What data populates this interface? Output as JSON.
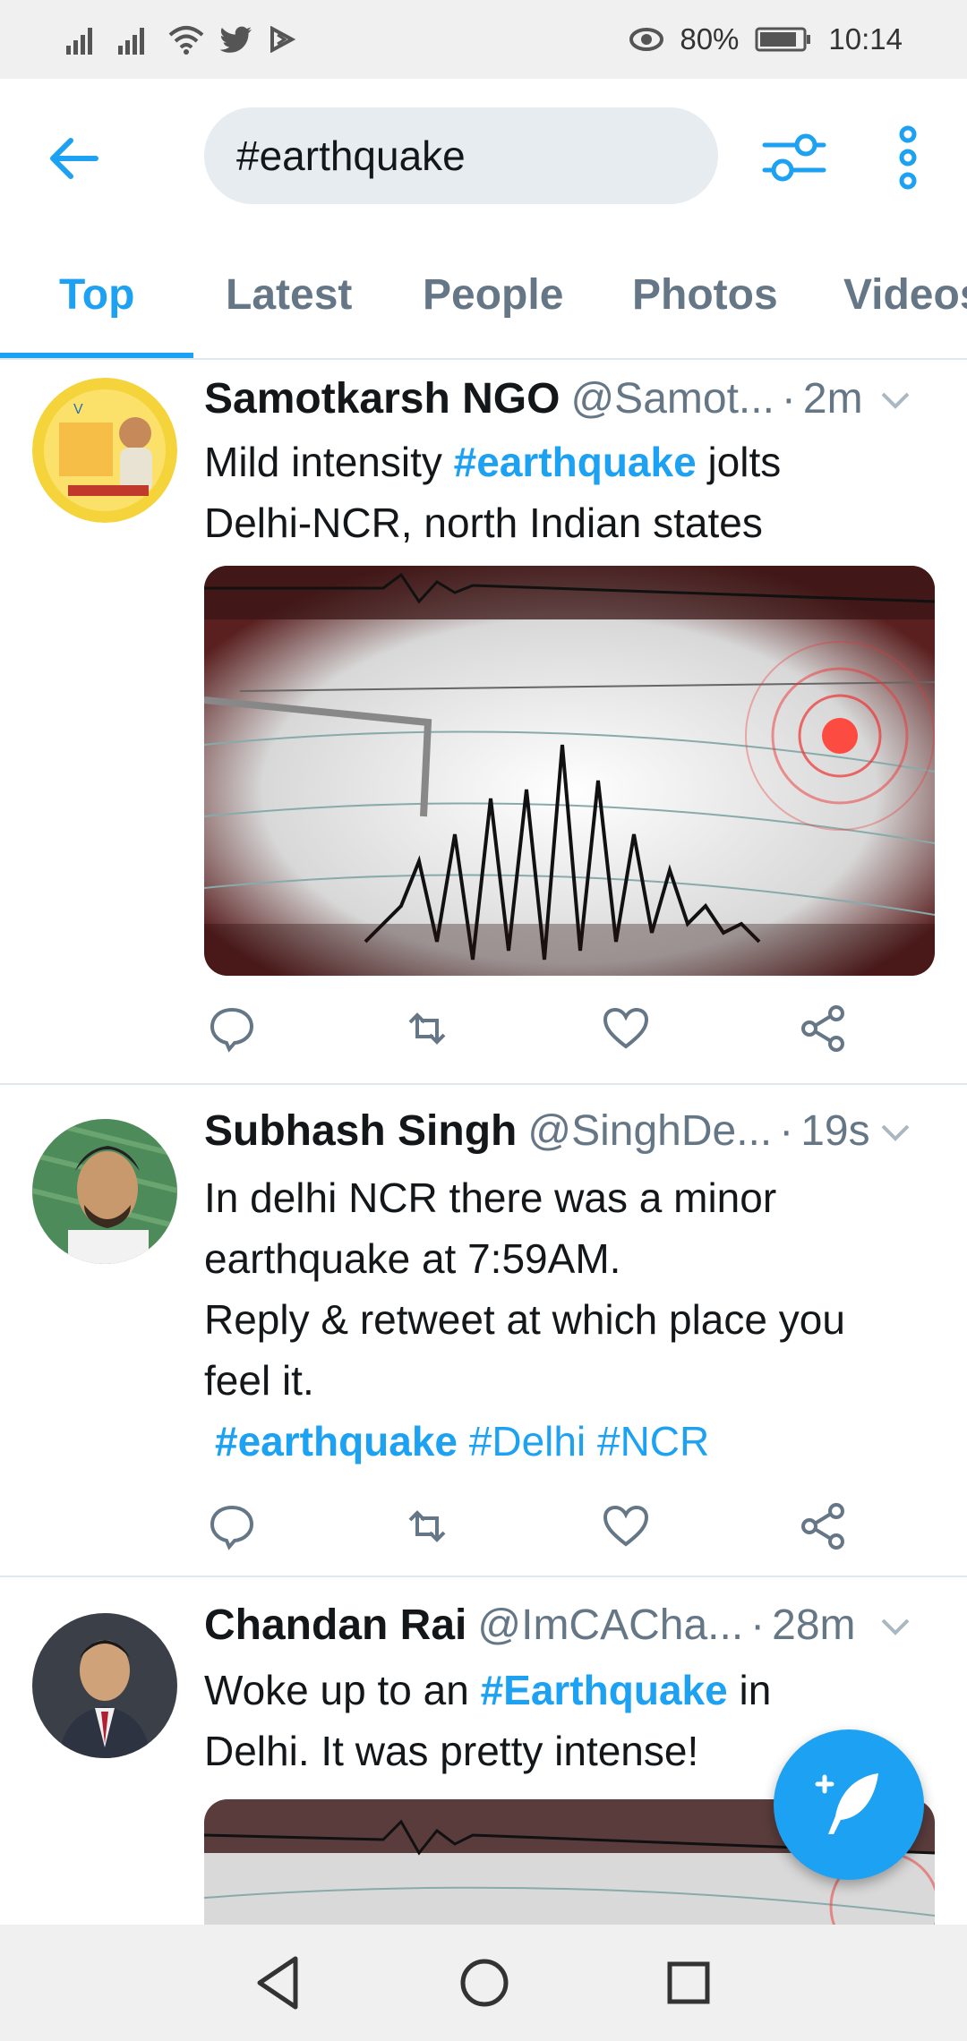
{
  "status_bar": {
    "battery": "80%",
    "time": "10:14",
    "left_icons": [
      "signal-icon",
      "signal-icon",
      "wifi-icon",
      "twitter-icon",
      "play-icon"
    ],
    "right_icons": [
      "eye-icon",
      "battery-icon"
    ]
  },
  "header": {
    "search_value": "#earthquake",
    "icons": [
      "back-arrow-icon",
      "filter-icon",
      "more-vertical-icon"
    ]
  },
  "tabs": [
    {
      "label": "Top",
      "active": true
    },
    {
      "label": "Latest",
      "active": false
    },
    {
      "label": "People",
      "active": false
    },
    {
      "label": "Photos",
      "active": false
    },
    {
      "label": "Videos",
      "active": false
    }
  ],
  "tweets": [
    {
      "name": "Samotkarsh NGO",
      "handle": "@Samot...",
      "time": "2m",
      "text_parts": [
        "Mild intensity ",
        "#earthquake",
        " jolts",
        "Delhi-NCR, north Indian states"
      ],
      "has_media": true
    },
    {
      "name": "Subhash Singh",
      "handle": "@SinghDe...",
      "time": "19s",
      "text_lines": [
        "In delhi NCR there was a minor",
        "earthquake at 7:59AM.",
        "Reply & retweet at which place you",
        "feel it."
      ],
      "hashtags": [
        "#earthquake",
        "#Delhi",
        "#NCR"
      ]
    },
    {
      "name": "Chandan Rai",
      "handle": "@ImCACha...",
      "time": "28m",
      "text_parts": [
        "Woke up to an ",
        "#Earthquake",
        " in",
        "Delhi. It was pretty intense!"
      ],
      "has_media": true
    }
  ],
  "tweet_sep": "·",
  "colors": {
    "accent": "#1da1f2",
    "text": "#14171a",
    "muted": "#657786",
    "search_bg": "#e6ecf0"
  }
}
